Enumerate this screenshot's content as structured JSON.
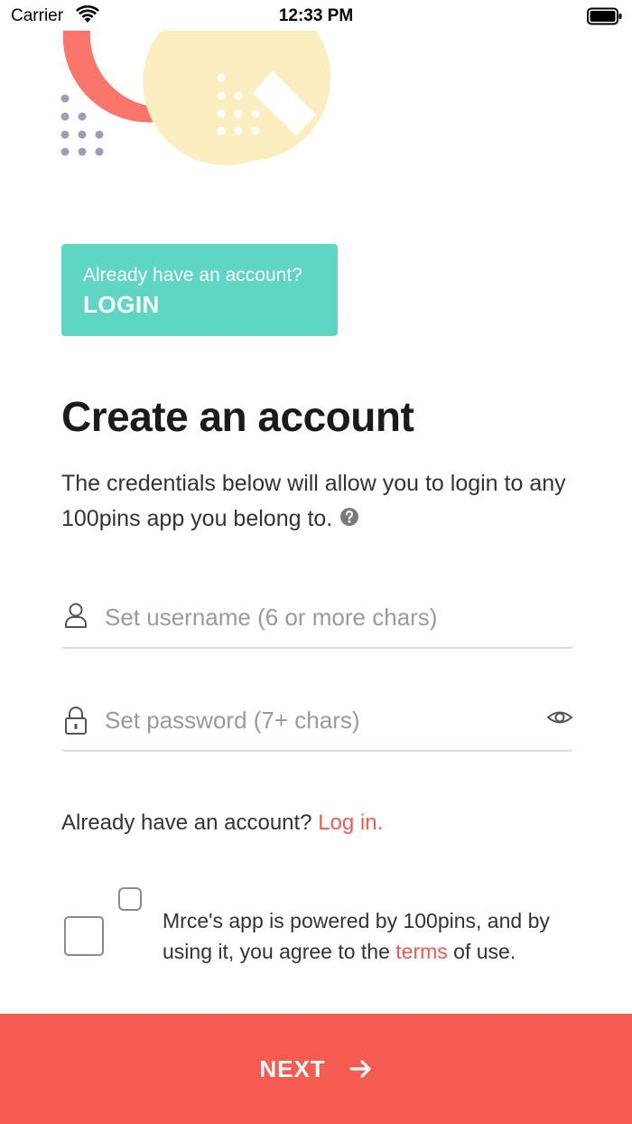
{
  "status_bar": {
    "carrier": "Carrier",
    "time": "12:33 PM"
  },
  "banner": {
    "question": "Already have an account?",
    "cta": "LOGIN"
  },
  "title": "Create an account",
  "intro": "The credentials below will allow you to login to any 100pins app you belong to.",
  "form": {
    "username_placeholder": "Set username (6 or more chars)",
    "password_placeholder": "Set password (7+ chars)"
  },
  "login_prompt": {
    "text": "Already have an account? ",
    "link": "Log in."
  },
  "terms": {
    "before": "Mrce's app is powered by 100pins, and by using it, you agree to the ",
    "link": "terms",
    "after": " of use."
  },
  "next": {
    "label": "NEXT"
  },
  "colors": {
    "accent": "#f55c4f",
    "teal": "#5fd5c4",
    "link": "#f15b4f",
    "hero_yellow": "#fdeec0",
    "hero_coral": "#fb7568",
    "hero_dots": "#a29bb8"
  }
}
